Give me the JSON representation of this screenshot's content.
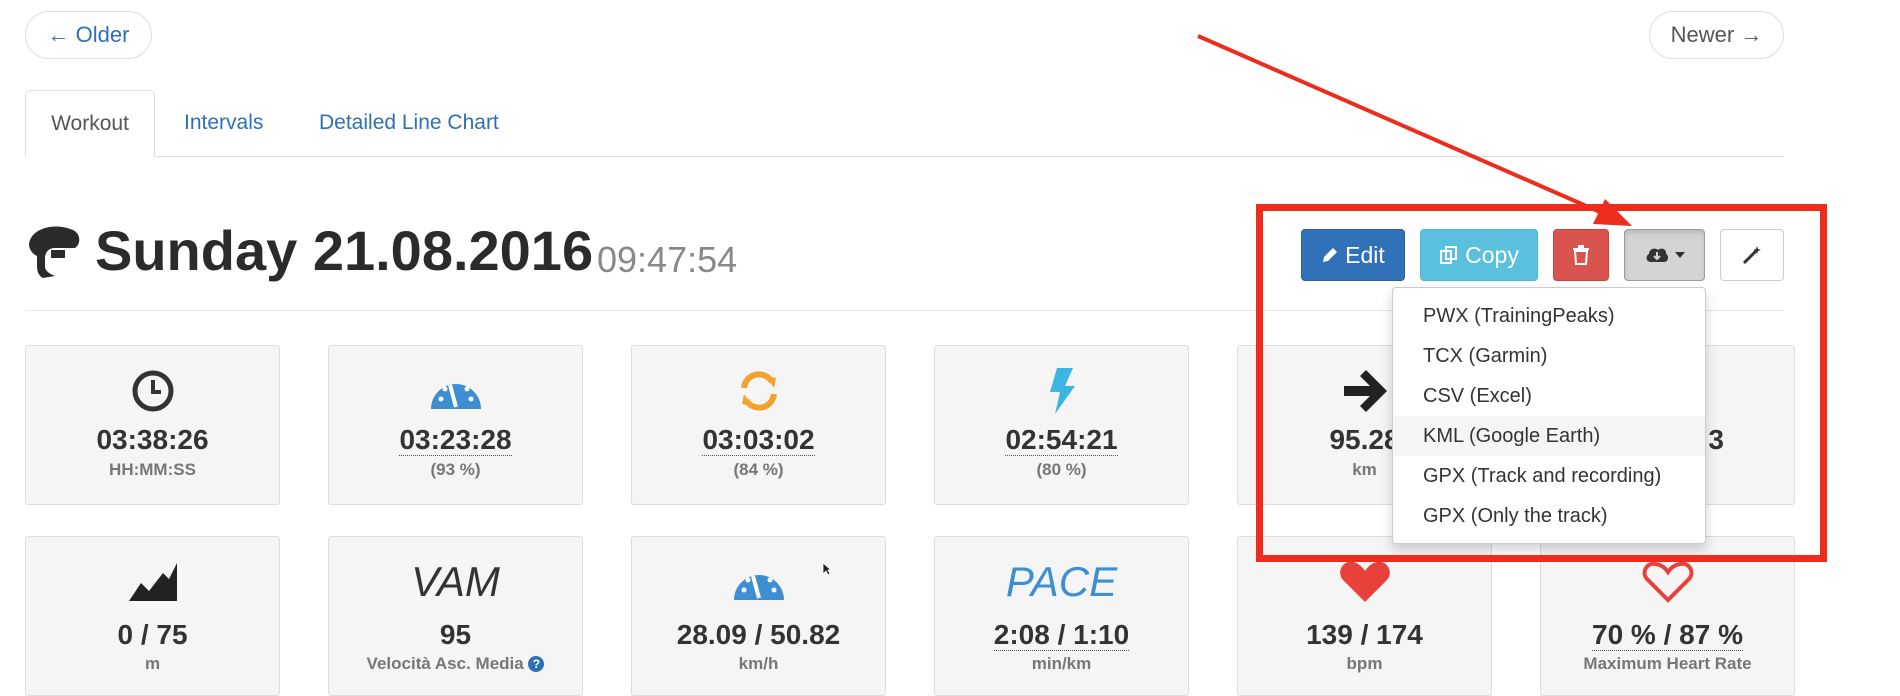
{
  "pager": {
    "older": "← Older",
    "newer": "Newer →"
  },
  "tabs": [
    "Workout",
    "Intervals",
    "Detailed Line Chart"
  ],
  "header": {
    "date": "Sunday 21.08.2016",
    "time": "09:47:54"
  },
  "toolbar": {
    "edit_label": "Edit",
    "copy_label": "Copy",
    "export_menu": [
      "PWX (TrainingPeaks)",
      "TCX (Garmin)",
      "CSV (Excel)",
      "KML (Google Earth)",
      "GPX (Track and recording)",
      "GPX (Only the track)"
    ]
  },
  "stats_row1": [
    {
      "icon": "clock-icon",
      "value": "03:38:26",
      "sub": "HH:MM:SS"
    },
    {
      "icon": "speedometer-icon",
      "value": "03:23:28",
      "sub": "(93 %)"
    },
    {
      "icon": "refresh-icon",
      "value": "03:03:02",
      "sub": "(84 %)"
    },
    {
      "icon": "bolt-icon",
      "value": "02:54:21",
      "sub": "(80 %)"
    },
    {
      "icon": "arrow-right-icon",
      "value": "95.28",
      "sub": "km"
    },
    {
      "icon": "",
      "value": "3",
      "sub": ""
    }
  ],
  "stats_row2": [
    {
      "icon": "elevation-icon",
      "value": "0 / 75",
      "sub": "m"
    },
    {
      "icon": "vam-text",
      "word": "VAM",
      "value": "95",
      "sub": "Velocità Asc. Media",
      "help": "?"
    },
    {
      "icon": "speedometer-icon",
      "value": "28.09 / 50.82",
      "sub": "km/h"
    },
    {
      "icon": "pace-text",
      "word": "PACE",
      "value": "2:08 / 1:10",
      "sub": "min/km"
    },
    {
      "icon": "heart-filled-icon",
      "value": "139 / 174",
      "sub": "bpm"
    },
    {
      "icon": "heart-outline-icon",
      "value": "70 % / 87 %",
      "sub": "Maximum Heart Rate"
    }
  ],
  "colors": {
    "accent_red": "#ec2d1d",
    "edit": "#3071b8",
    "copy": "#5bc0de",
    "delete": "#d9534f",
    "icon_blue": "#3e8fd1",
    "icon_orange": "#f0a32f",
    "heart": "#e8413c"
  }
}
